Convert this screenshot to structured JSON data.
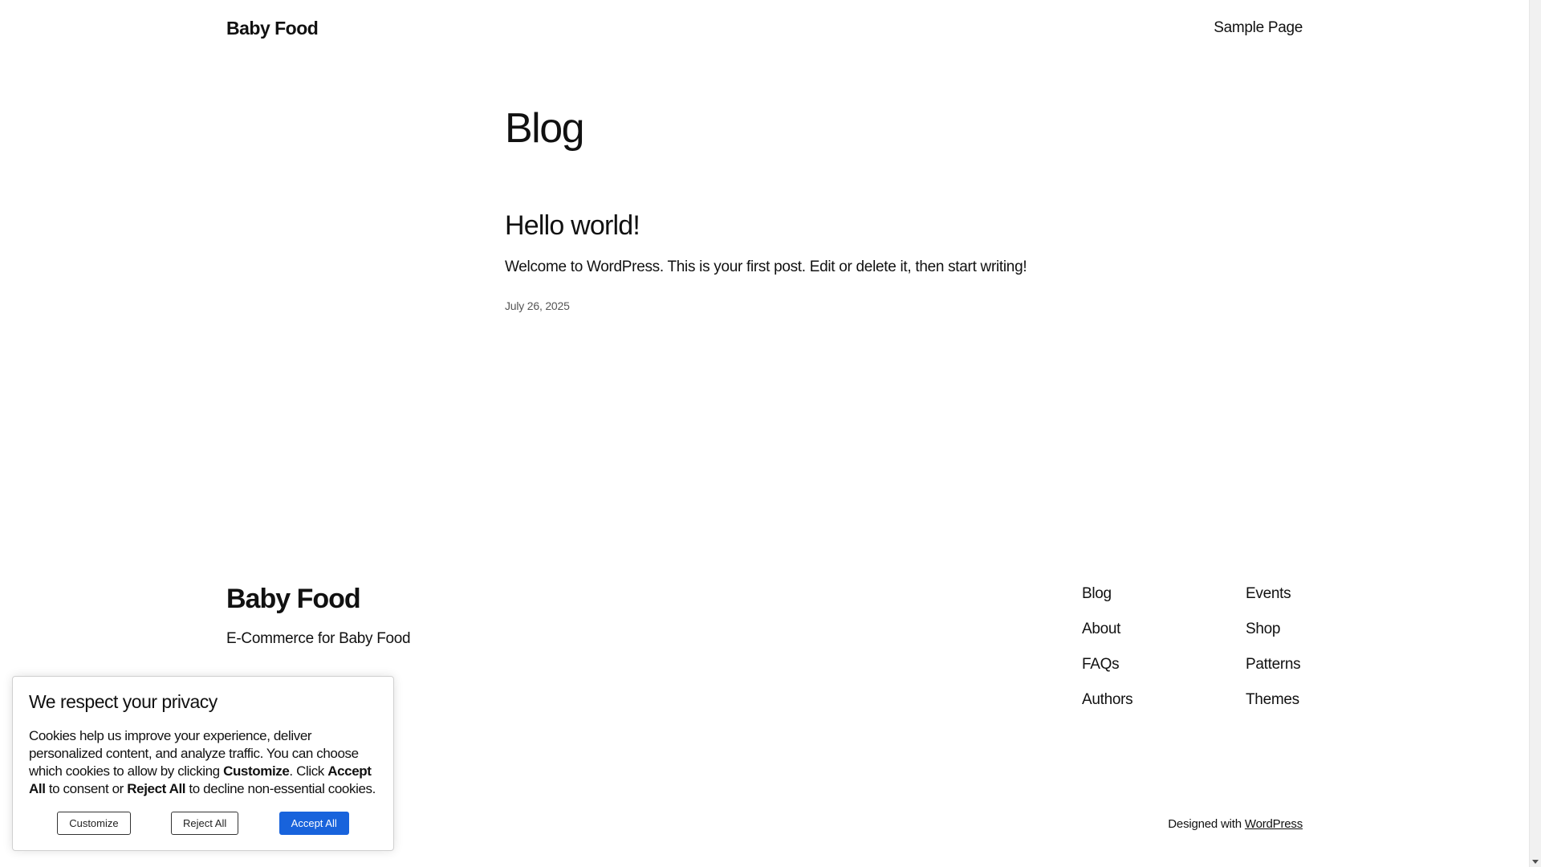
{
  "header": {
    "site_title": "Baby Food",
    "nav": [
      "Sample Page"
    ]
  },
  "main": {
    "heading": "Blog",
    "posts": [
      {
        "title": "Hello world!",
        "excerpt": "Welcome to WordPress. This is your first post. Edit or delete it, then start writing!",
        "date": "July 26, 2025"
      }
    ]
  },
  "footer": {
    "title": "Baby Food",
    "tagline": "E-Commerce for Baby Food",
    "nav_col1": [
      "Blog",
      "About",
      "FAQs",
      "Authors"
    ],
    "nav_col2": [
      "Events",
      "Shop",
      "Patterns",
      "Themes"
    ],
    "credit_prefix": "Designed with",
    "credit_link": "WordPress"
  },
  "cookie": {
    "title": "We respect your privacy",
    "text_1": "Cookies help us improve your experience, deliver personalized content, and analyze traffic. You can choose which cookies to allow by clicking ",
    "strong_customize": "Customize",
    "text_2": ". Click ",
    "strong_accept": "Accept All",
    "text_3": " to consent or ",
    "strong_reject": "Reject All",
    "text_4": " to decline non-essential cookies.",
    "buttons": {
      "customize": "Customize",
      "reject": "Reject All",
      "accept": "Accept All"
    },
    "accept_color": "#1863dc"
  }
}
